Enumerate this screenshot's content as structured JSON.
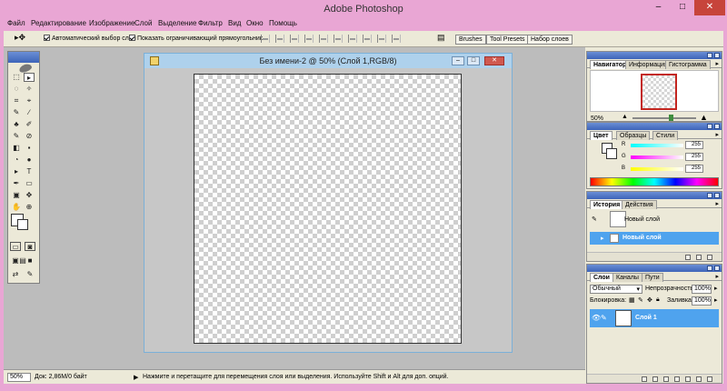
{
  "window": {
    "title": "Adobe Photoshop",
    "minimize_glyph": "–",
    "maximize_glyph": "□",
    "close_glyph": "✕"
  },
  "menu": [
    "Файл",
    "Редактирование",
    "Изображение",
    "Слой",
    "Выделение",
    "Фильтр",
    "Вид",
    "Окно",
    "Помощь"
  ],
  "options": {
    "tool_glyph": "▸✥",
    "auto_select_label": "Автоматический выбор слоя",
    "auto_select_checked": true,
    "show_bbox_label": "Показать ограничивающий прямоугольник",
    "show_bbox_checked": true,
    "well_tabs": [
      "Brushes",
      "Tool Presets",
      "Набор слоев"
    ]
  },
  "document": {
    "title": "Без имени-2 @ 50% (Слой 1,RGB/8)",
    "min_glyph": "–",
    "max_glyph": "□",
    "close_glyph": "✕"
  },
  "tools": {
    "glyphs": [
      "⬚",
      "▸",
      "◌",
      "✧",
      "⌗",
      "⌖",
      "✎",
      "∕",
      "♣",
      "✐",
      "✎",
      "⊘",
      "◧",
      "▪",
      "◔",
      "●",
      "▸",
      "T",
      "✒",
      "▭",
      "▣",
      "✥",
      "✋",
      "⊕"
    ]
  },
  "status": {
    "zoom": "50%",
    "doc_info": "Док: 2,86М/0 байт",
    "arrow": "▶",
    "hint": "Нажмите и перетащите для перемещения слоя или выделения. Используйте Shift и Alt для доп. опций."
  },
  "navigator": {
    "tabs": [
      "Навигатор",
      "Информация",
      "Гистограмма"
    ],
    "zoom": "50%"
  },
  "color": {
    "tabs": [
      "Цвет",
      "Образцы",
      "Стили"
    ],
    "channels": [
      {
        "label": "R",
        "value": "255",
        "gradient": "linear-gradient(90deg,#00ffff,#ffffff)"
      },
      {
        "label": "G",
        "value": "255",
        "gradient": "linear-gradient(90deg,#ff00ff,#ffffff)"
      },
      {
        "label": "B",
        "value": "255",
        "gradient": "linear-gradient(90deg,#ffff00,#ffffff)"
      }
    ]
  },
  "history": {
    "tabs": [
      "История",
      "Действия"
    ],
    "snapshot_label": "Новый слой",
    "active_item": "Новый слой"
  },
  "layers": {
    "tabs": [
      "Слои",
      "Каналы",
      "Пути"
    ],
    "blend_mode": "Обычный",
    "opacity_label": "Непрозрачность:",
    "opacity_value": "100%",
    "lock_label": "Блокировка:",
    "fill_label": "Заливка:",
    "fill_value": "100%",
    "layer_name": "Слой 1"
  },
  "colors": {
    "accent_blue": "#4fa3ee",
    "titlebar_pink": "#e9a6d4",
    "close_red": "#c7443b"
  }
}
